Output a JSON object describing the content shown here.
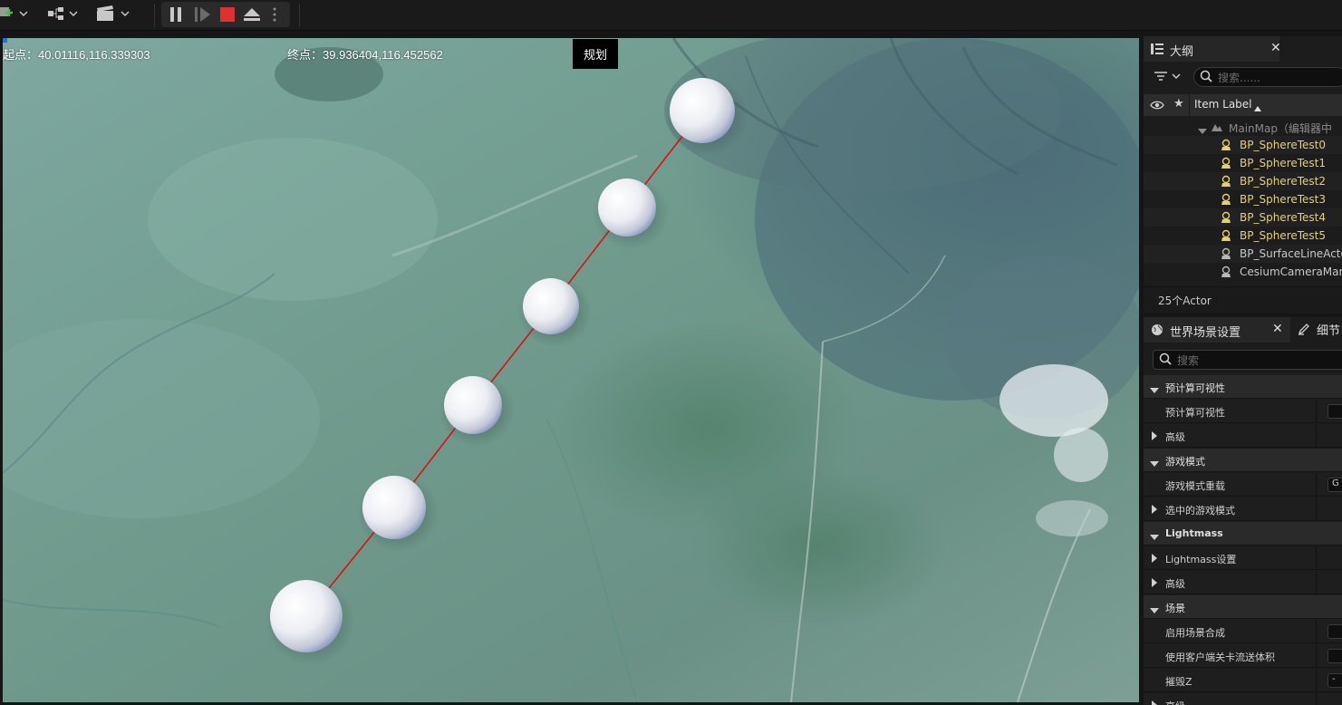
{
  "toolbar": {
    "add_icon": "add-actor-icon",
    "blueprint_icon": "blueprint-icon",
    "cinematics_icon": "clapperboard-icon",
    "pause_icon": "pause-icon",
    "step_icon": "frame-skip-icon",
    "stop_icon": "stop-icon",
    "eject_icon": "eject-icon",
    "more_icon": "more-options-icon",
    "stop_color": "#e03030"
  },
  "viewport": {
    "start_label": "起点：",
    "start_value": "40.01116,116.339303",
    "end_label": "终点：",
    "end_value": "39.936404,116.452562",
    "plan_button": "规划",
    "route_color": "#e01010",
    "sphere_count": 6
  },
  "outliner": {
    "title": "大纲",
    "search_placeholder": "搜索......",
    "column_label": "Item Label",
    "map_label": "MainMap（编辑器中",
    "items": [
      {
        "label": "BP_SphereTest0",
        "selected": true
      },
      {
        "label": "BP_SphereTest1",
        "selected": true
      },
      {
        "label": "BP_SphereTest2",
        "selected": true
      },
      {
        "label": "BP_SphereTest3",
        "selected": true
      },
      {
        "label": "BP_SphereTest4",
        "selected": true
      },
      {
        "label": "BP_SphereTest5",
        "selected": true
      },
      {
        "label": "BP_SurfaceLineActo",
        "selected": false
      },
      {
        "label": "CesiumCameraMan",
        "selected": false
      }
    ],
    "footer": "25个Actor"
  },
  "details": {
    "tab_world": "世界场景设置",
    "tab_details": "细节",
    "search_placeholder": "搜索",
    "rows": [
      {
        "type": "category",
        "label": "预计算可视性",
        "expanded": true
      },
      {
        "type": "property",
        "label": "预计算可视性"
      },
      {
        "type": "sub",
        "label": "高级"
      },
      {
        "type": "category",
        "label": "游戏模式",
        "expanded": true
      },
      {
        "type": "property",
        "label": "游戏模式重载",
        "value": "G"
      },
      {
        "type": "sub",
        "label": "选中的游戏模式"
      },
      {
        "type": "category",
        "label": "Lightmass",
        "expanded": true
      },
      {
        "type": "sub",
        "label": "Lightmass设置"
      },
      {
        "type": "sub",
        "label": "高级"
      },
      {
        "type": "category",
        "label": "场景",
        "expanded": true
      },
      {
        "type": "property",
        "label": "启用场景合成"
      },
      {
        "type": "property",
        "label": "使用客户端关卡流送体积"
      },
      {
        "type": "property",
        "label": "摧毁Z",
        "value": "-"
      },
      {
        "type": "sub",
        "label": "高级"
      }
    ]
  }
}
